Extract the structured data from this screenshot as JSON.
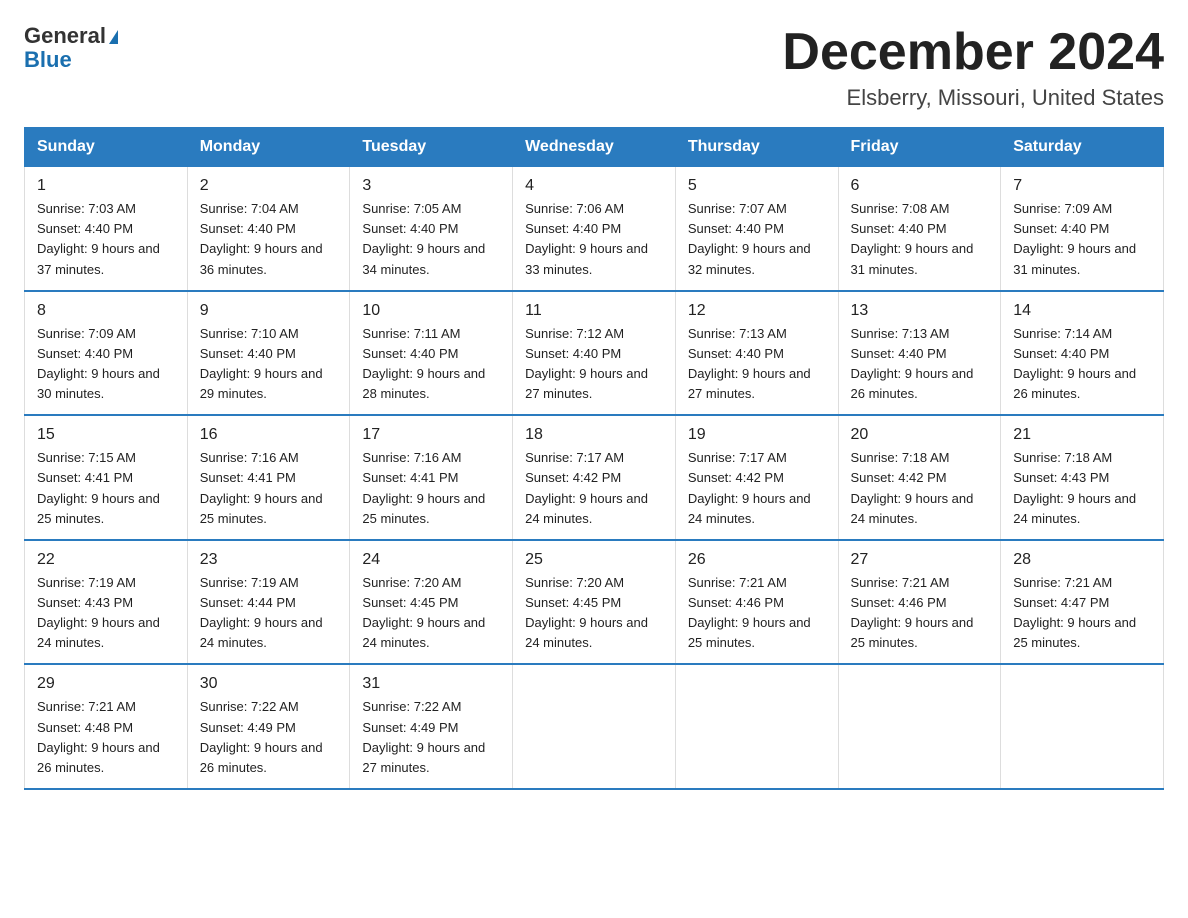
{
  "header": {
    "logo_line1": "General",
    "logo_line2": "Blue",
    "title": "December 2024",
    "subtitle": "Elsberry, Missouri, United States"
  },
  "weekdays": [
    "Sunday",
    "Monday",
    "Tuesday",
    "Wednesday",
    "Thursday",
    "Friday",
    "Saturday"
  ],
  "weeks": [
    [
      {
        "day": "1",
        "sunrise": "7:03 AM",
        "sunset": "4:40 PM",
        "daylight": "9 hours and 37 minutes."
      },
      {
        "day": "2",
        "sunrise": "7:04 AM",
        "sunset": "4:40 PM",
        "daylight": "9 hours and 36 minutes."
      },
      {
        "day": "3",
        "sunrise": "7:05 AM",
        "sunset": "4:40 PM",
        "daylight": "9 hours and 34 minutes."
      },
      {
        "day": "4",
        "sunrise": "7:06 AM",
        "sunset": "4:40 PM",
        "daylight": "9 hours and 33 minutes."
      },
      {
        "day": "5",
        "sunrise": "7:07 AM",
        "sunset": "4:40 PM",
        "daylight": "9 hours and 32 minutes."
      },
      {
        "day": "6",
        "sunrise": "7:08 AM",
        "sunset": "4:40 PM",
        "daylight": "9 hours and 31 minutes."
      },
      {
        "day": "7",
        "sunrise": "7:09 AM",
        "sunset": "4:40 PM",
        "daylight": "9 hours and 31 minutes."
      }
    ],
    [
      {
        "day": "8",
        "sunrise": "7:09 AM",
        "sunset": "4:40 PM",
        "daylight": "9 hours and 30 minutes."
      },
      {
        "day": "9",
        "sunrise": "7:10 AM",
        "sunset": "4:40 PM",
        "daylight": "9 hours and 29 minutes."
      },
      {
        "day": "10",
        "sunrise": "7:11 AM",
        "sunset": "4:40 PM",
        "daylight": "9 hours and 28 minutes."
      },
      {
        "day": "11",
        "sunrise": "7:12 AM",
        "sunset": "4:40 PM",
        "daylight": "9 hours and 27 minutes."
      },
      {
        "day": "12",
        "sunrise": "7:13 AM",
        "sunset": "4:40 PM",
        "daylight": "9 hours and 27 minutes."
      },
      {
        "day": "13",
        "sunrise": "7:13 AM",
        "sunset": "4:40 PM",
        "daylight": "9 hours and 26 minutes."
      },
      {
        "day": "14",
        "sunrise": "7:14 AM",
        "sunset": "4:40 PM",
        "daylight": "9 hours and 26 minutes."
      }
    ],
    [
      {
        "day": "15",
        "sunrise": "7:15 AM",
        "sunset": "4:41 PM",
        "daylight": "9 hours and 25 minutes."
      },
      {
        "day": "16",
        "sunrise": "7:16 AM",
        "sunset": "4:41 PM",
        "daylight": "9 hours and 25 minutes."
      },
      {
        "day": "17",
        "sunrise": "7:16 AM",
        "sunset": "4:41 PM",
        "daylight": "9 hours and 25 minutes."
      },
      {
        "day": "18",
        "sunrise": "7:17 AM",
        "sunset": "4:42 PM",
        "daylight": "9 hours and 24 minutes."
      },
      {
        "day": "19",
        "sunrise": "7:17 AM",
        "sunset": "4:42 PM",
        "daylight": "9 hours and 24 minutes."
      },
      {
        "day": "20",
        "sunrise": "7:18 AM",
        "sunset": "4:42 PM",
        "daylight": "9 hours and 24 minutes."
      },
      {
        "day": "21",
        "sunrise": "7:18 AM",
        "sunset": "4:43 PM",
        "daylight": "9 hours and 24 minutes."
      }
    ],
    [
      {
        "day": "22",
        "sunrise": "7:19 AM",
        "sunset": "4:43 PM",
        "daylight": "9 hours and 24 minutes."
      },
      {
        "day": "23",
        "sunrise": "7:19 AM",
        "sunset": "4:44 PM",
        "daylight": "9 hours and 24 minutes."
      },
      {
        "day": "24",
        "sunrise": "7:20 AM",
        "sunset": "4:45 PM",
        "daylight": "9 hours and 24 minutes."
      },
      {
        "day": "25",
        "sunrise": "7:20 AM",
        "sunset": "4:45 PM",
        "daylight": "9 hours and 24 minutes."
      },
      {
        "day": "26",
        "sunrise": "7:21 AM",
        "sunset": "4:46 PM",
        "daylight": "9 hours and 25 minutes."
      },
      {
        "day": "27",
        "sunrise": "7:21 AM",
        "sunset": "4:46 PM",
        "daylight": "9 hours and 25 minutes."
      },
      {
        "day": "28",
        "sunrise": "7:21 AM",
        "sunset": "4:47 PM",
        "daylight": "9 hours and 25 minutes."
      }
    ],
    [
      {
        "day": "29",
        "sunrise": "7:21 AM",
        "sunset": "4:48 PM",
        "daylight": "9 hours and 26 minutes."
      },
      {
        "day": "30",
        "sunrise": "7:22 AM",
        "sunset": "4:49 PM",
        "daylight": "9 hours and 26 minutes."
      },
      {
        "day": "31",
        "sunrise": "7:22 AM",
        "sunset": "4:49 PM",
        "daylight": "9 hours and 27 minutes."
      },
      null,
      null,
      null,
      null
    ]
  ]
}
